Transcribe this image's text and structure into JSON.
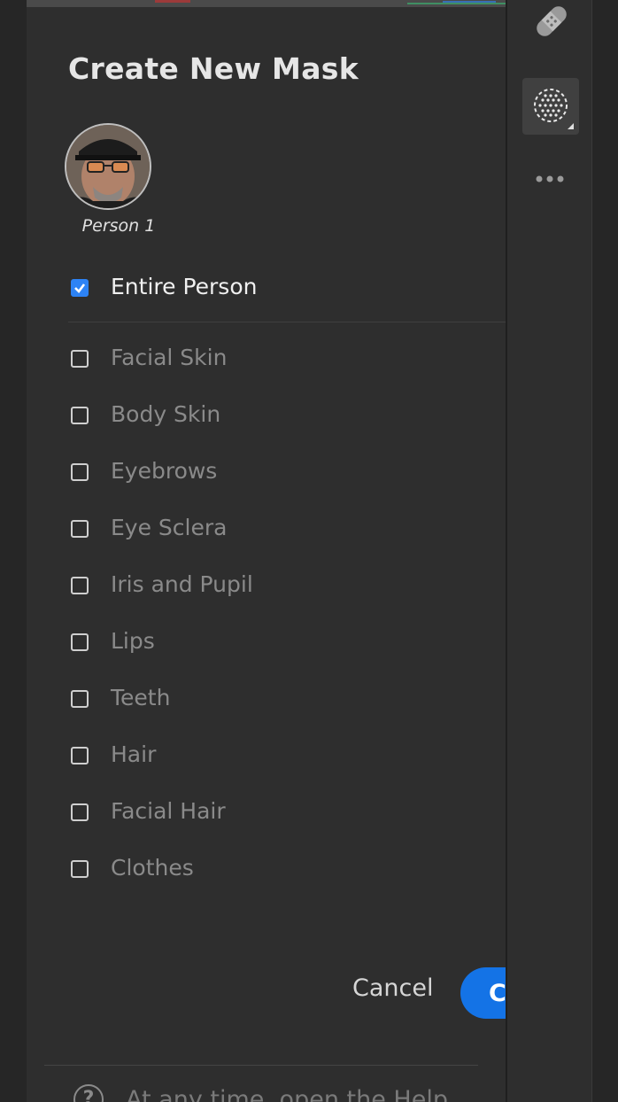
{
  "dialog": {
    "title": "Create New Mask",
    "person_label": "Person 1",
    "entire_person": {
      "label": "Entire Person",
      "checked": true
    },
    "parts": [
      {
        "label": "Facial Skin",
        "checked": false
      },
      {
        "label": "Body Skin",
        "checked": false
      },
      {
        "label": "Eyebrows",
        "checked": false
      },
      {
        "label": "Eye Sclera",
        "checked": false
      },
      {
        "label": "Iris and Pupil",
        "checked": false
      },
      {
        "label": "Lips",
        "checked": false
      },
      {
        "label": "Teeth",
        "checked": false
      },
      {
        "label": "Hair",
        "checked": false
      },
      {
        "label": "Facial Hair",
        "checked": false
      },
      {
        "label": "Clothes",
        "checked": false
      }
    ],
    "cancel_label": "Cancel",
    "create_label": "C",
    "help_text": "At any time, open the Help"
  },
  "toolstrip": {
    "icons": [
      "healing-bandage-icon",
      "masking-icon",
      "more-options-icon"
    ]
  },
  "colors": {
    "accent": "#1473e6",
    "checkbox_checked": "#2d83f5",
    "panel_bg": "#2e2e2e"
  }
}
